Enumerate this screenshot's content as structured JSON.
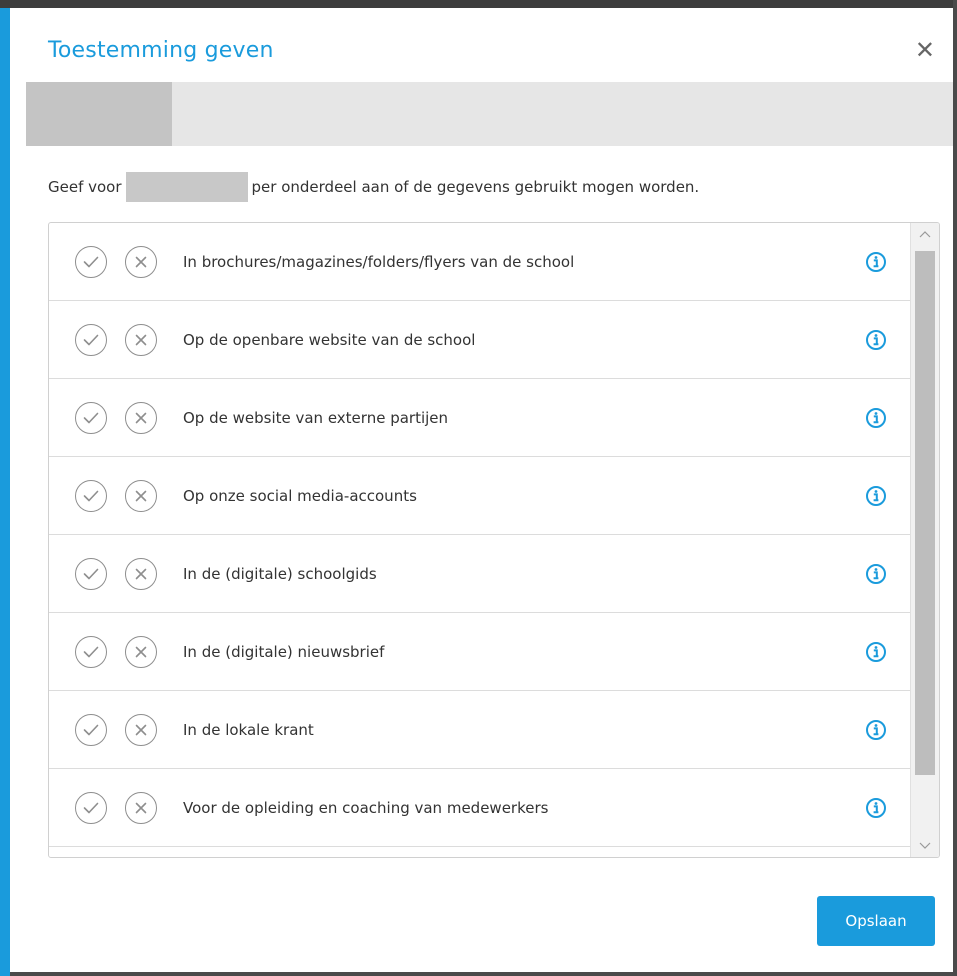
{
  "dialog": {
    "title": "Toestemming geven",
    "close_icon": "close-icon",
    "intro_prefix": "Geef voor",
    "intro_suffix": "per onderdeel aan of de gegevens gebruikt mogen worden."
  },
  "items": [
    {
      "label": "In brochures/magazines/folders/flyers van de school"
    },
    {
      "label": "Op de openbare website van de school"
    },
    {
      "label": "Op de website van externe partijen"
    },
    {
      "label": "Op onze social media-accounts"
    },
    {
      "label": "In de (digitale) schoolgids"
    },
    {
      "label": "In de (digitale) nieuwsbrief"
    },
    {
      "label": "In de lokale krant"
    },
    {
      "label": "Voor de opleiding en coaching van medewerkers"
    }
  ],
  "actions": {
    "save_label": "Opslaan"
  },
  "colors": {
    "accent": "#1a9bdc",
    "icon_gray": "#8e8e8e"
  }
}
